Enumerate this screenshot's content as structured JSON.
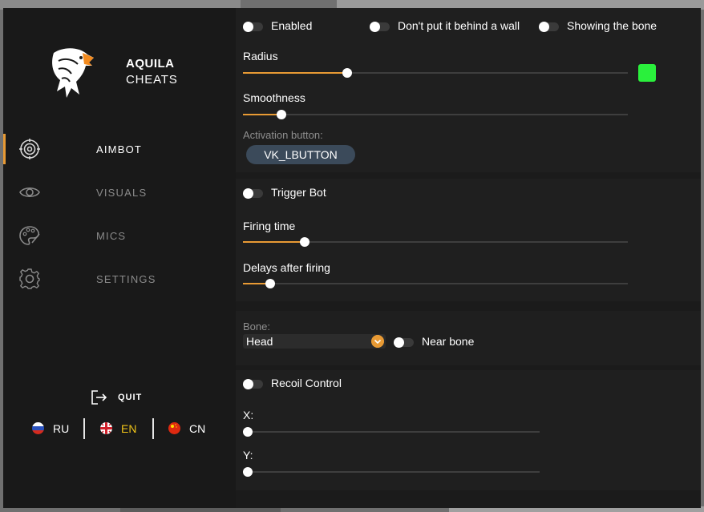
{
  "brand": {
    "line1": "AQUILA",
    "line2": "CHEATS"
  },
  "sidebar": {
    "items": [
      {
        "label": "AIMBOT",
        "icon": "crosshair-icon",
        "active": true
      },
      {
        "label": "VISUALS",
        "icon": "eye-icon",
        "active": false
      },
      {
        "label": "MICS",
        "icon": "palette-icon",
        "active": false
      },
      {
        "label": "SETTINGS",
        "icon": "gear-icon",
        "active": false
      }
    ],
    "quit_label": "QUIT",
    "languages": [
      {
        "code": "RU",
        "active": false
      },
      {
        "code": "EN",
        "active": true
      },
      {
        "code": "CN",
        "active": false
      }
    ]
  },
  "aimbot": {
    "enabled_label": "Enabled",
    "behind_wall_label": "Don't put it behind a wall",
    "showing_bone_label": "Showing the bone",
    "radius_label": "Radius",
    "radius_value": 0.27,
    "radius_color": "#2af03c",
    "smoothness_label": "Smoothness",
    "smoothness_value": 0.1,
    "activation_label": "Activation button:",
    "activation_key": "VK_LBUTTON"
  },
  "trigger": {
    "label": "Trigger Bot",
    "firing_time_label": "Firing time",
    "firing_time_value": 0.16,
    "delays_label": "Delays after firing",
    "delays_value": 0.07
  },
  "bone": {
    "label": "Bone:",
    "value": "Head",
    "near_bone_label": "Near bone"
  },
  "recoil": {
    "label": "Recoil Control",
    "x_label": "X:",
    "x_value": 0.0,
    "y_label": "Y:",
    "y_value": 0.0
  },
  "colors": {
    "accent": "#e89a34",
    "active_language": "#f0c419",
    "key_button": "#3b4a5a"
  }
}
